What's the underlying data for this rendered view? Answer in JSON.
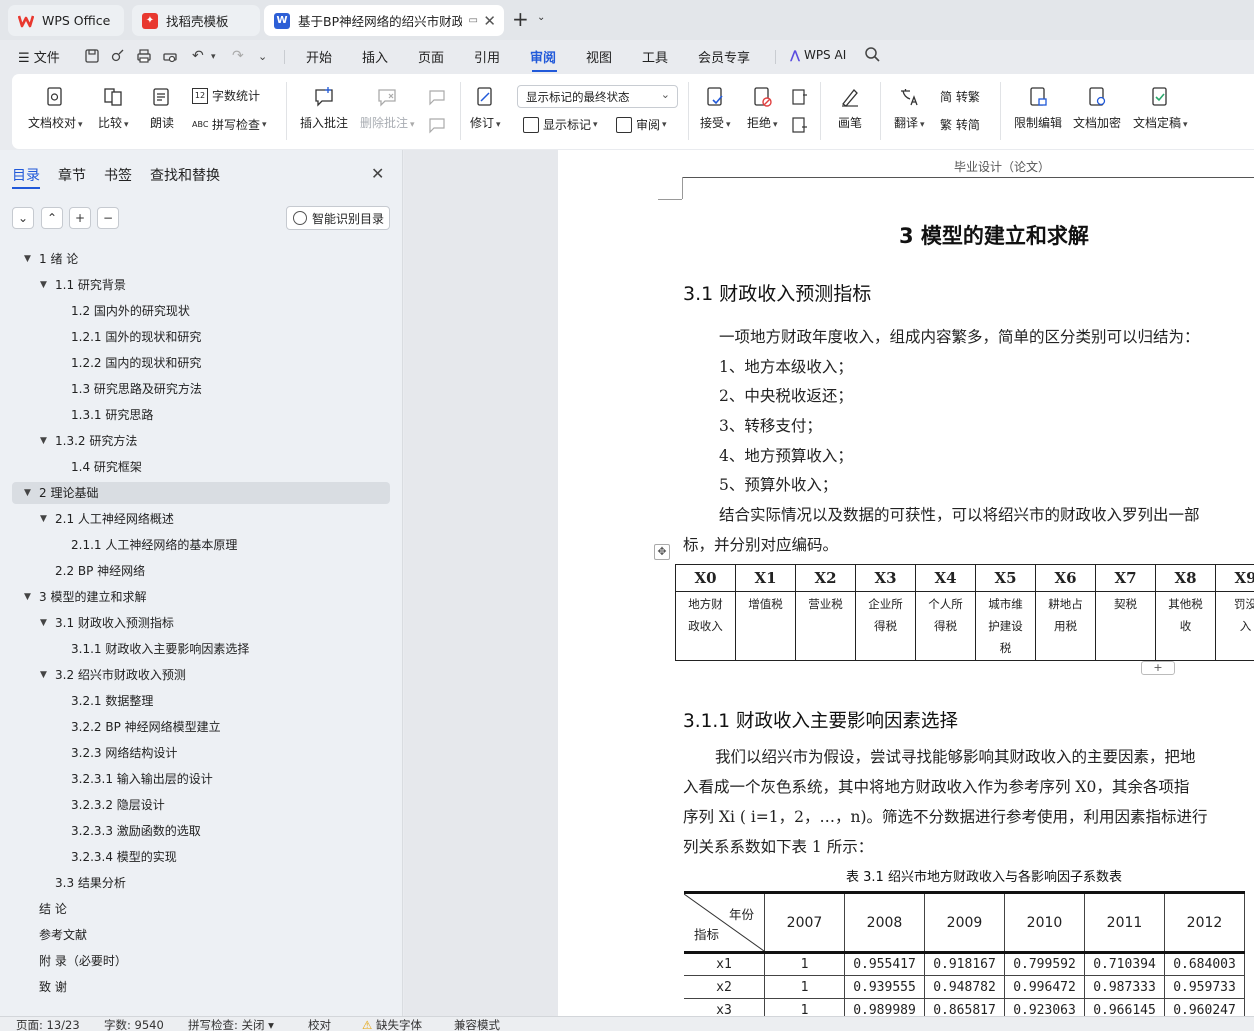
{
  "tabs": [
    {
      "label": "WPS Office",
      "icon": "wps-logo-icon"
    },
    {
      "label": "找稻壳模板",
      "icon": "docer-icon"
    },
    {
      "label": "基于BP神经网络的绍兴市财政",
      "icon": "word-doc-icon",
      "active": true
    }
  ],
  "menu": {
    "file": "文件",
    "items": [
      "开始",
      "插入",
      "页面",
      "引用",
      "审阅",
      "视图",
      "工具",
      "会员专享"
    ],
    "active": "审阅",
    "ai": "WPS AI"
  },
  "ribbon": {
    "doc_check": "文档校对",
    "compare": "比较",
    "read_aloud": "朗读",
    "word_count": "字数统计",
    "spell_check": "拼写检查",
    "insert_comment": "插入批注",
    "delete_comment": "删除批注",
    "track_changes": "修订",
    "markup_mode": "显示标记的最终状态",
    "show_markup": "显示标记",
    "review": "审阅",
    "accept": "接受",
    "reject": "拒绝",
    "pen": "画笔",
    "translate": "翻译",
    "to_traditional": "简 转繁",
    "to_simplified": "繁 转简",
    "restrict_edit": "限制编辑",
    "encrypt": "文档加密",
    "finalize": "文档定稿"
  },
  "nav": {
    "tabs": [
      "目录",
      "章节",
      "书签",
      "查找和替换"
    ],
    "smart_toc": "智能识别目录",
    "toc": [
      {
        "level": 1,
        "text": "1  绪  论",
        "expanded": true
      },
      {
        "level": 2,
        "text": "1.1  研究背景",
        "expanded": true
      },
      {
        "level": 3,
        "text": "1.2  国内外的研究现状"
      },
      {
        "level": 3,
        "text": "1.2.1 国外的现状和研究"
      },
      {
        "level": 3,
        "text": "1.2.2 国内的现状和研究"
      },
      {
        "level": 3,
        "text": "1.3 研究思路及研究方法"
      },
      {
        "level": 3,
        "text": "1.3.1 研究思路"
      },
      {
        "level": 2,
        "text": "1.3.2  研究方法",
        "expanded": true
      },
      {
        "level": 3,
        "text": "1.4  研究框架"
      },
      {
        "level": 1,
        "text": "2  理论基础",
        "expanded": true,
        "selected": true
      },
      {
        "level": 2,
        "text": "2.1  人工神经网络概述",
        "expanded": true
      },
      {
        "level": 3,
        "text": "2.1.1  人工神经网络的基本原理"
      },
      {
        "level": 2,
        "text": "2.2 BP 神经网络",
        "leaf": true
      },
      {
        "level": 1,
        "text": "3  模型的建立和求解",
        "expanded": true
      },
      {
        "level": 2,
        "text": "3.1 财政收入预测指标",
        "expanded": true
      },
      {
        "level": 3,
        "text": "3.1.1 财政收入主要影响因素选择"
      },
      {
        "level": 2,
        "text": "3.2 绍兴市财政收入预测",
        "expanded": true
      },
      {
        "level": 3,
        "text": "3.2.1 数据整理"
      },
      {
        "level": 3,
        "text": "3.2.2 BP 神经网络模型建立"
      },
      {
        "level": 3,
        "text": "3.2.3 网络结构设计"
      },
      {
        "level": 3,
        "text": "3.2.3.1 输入输出层的设计"
      },
      {
        "level": 3,
        "text": "3.2.3.2 隐层设计"
      },
      {
        "level": 3,
        "text": "3.2.3.3  激励函数的选取"
      },
      {
        "level": 3,
        "text": "3.2.3.4  模型的实现"
      },
      {
        "level": 2,
        "text": "3.3 结果分析",
        "leaf": true
      },
      {
        "level": 1,
        "text": "结  论",
        "leaf": true
      },
      {
        "level": 1,
        "text": "参考文献",
        "leaf": true
      },
      {
        "level": 1,
        "text": "附  录（必要时）",
        "leaf": true
      },
      {
        "level": 1,
        "text": "致  谢",
        "leaf": true
      }
    ]
  },
  "doc": {
    "header": "毕业设计（论文）",
    "chapter_title": "3  模型的建立和求解",
    "sec31_title": "3.1 财政收入预测指标",
    "p1": "一项地方财政年度收入，组成内容繁多，简单的区分类别可以归结为：",
    "list": [
      "1、地方本级收入；",
      "2、中央税收返还；",
      "3、转移支付；",
      "4、地方预算收入；",
      "5、预算外收入；"
    ],
    "p2a": "结合实际情况以及数据的可获性，可以将绍兴市的财政收入罗列出一部",
    "p2b": "标，并分别对应编码。",
    "code_table": {
      "codes": [
        "X0",
        "X1",
        "X2",
        "X3",
        "X4",
        "X5",
        "X6",
        "X7",
        "X8",
        "X9"
      ],
      "names": [
        [
          "地方财",
          "政收入"
        ],
        [
          "增值税"
        ],
        [
          "营业税"
        ],
        [
          "企业所",
          "得税"
        ],
        [
          "个人所",
          "得税"
        ],
        [
          "城市维",
          "护建设",
          "税"
        ],
        [
          "耕地占",
          "用税"
        ],
        [
          "契税"
        ],
        [
          "其他税",
          "收"
        ],
        [
          "罚没",
          "入"
        ]
      ]
    },
    "sec311_title": "3.1.1 财政收入主要影响因素选择",
    "p3": [
      "我们以绍兴市为假设，尝试寻找能够影响其财政收入的主要因素，把地",
      "入看成一个灰色系统，其中将地方财政收入作为参考序列 X0，其余各项指",
      "序列 Xi ( i=1，2，…，n)。筛选不分数据进行参考使用，利用因素指标进行",
      "列关系系数如下表 1 所示："
    ],
    "table_caption": "表 3.1 绍兴市地方财政收入与各影响因子系数表",
    "coef_table": {
      "corner_top": "年份",
      "corner_bottom": "指标",
      "years": [
        "2007",
        "2008",
        "2009",
        "2010",
        "2011",
        "2012"
      ],
      "rows": [
        {
          "name": "x1",
          "values": [
            "1",
            "0.955417",
            "0.918167",
            "0.799592",
            "0.710394",
            "0.684003"
          ]
        },
        {
          "name": "x2",
          "values": [
            "1",
            "0.939555",
            "0.948782",
            "0.996472",
            "0.987333",
            "0.959733"
          ]
        },
        {
          "name": "x3",
          "values": [
            "1",
            "0.989989",
            "0.865817",
            "0.923063",
            "0.966145",
            "0.960247"
          ]
        }
      ]
    }
  },
  "status": {
    "page": "页面: 13/23",
    "words": "字数: 9540",
    "spell": "拼写检查: 关闭",
    "proof": "校对",
    "missing_font": "缺失字体",
    "compat": "兼容模式"
  }
}
